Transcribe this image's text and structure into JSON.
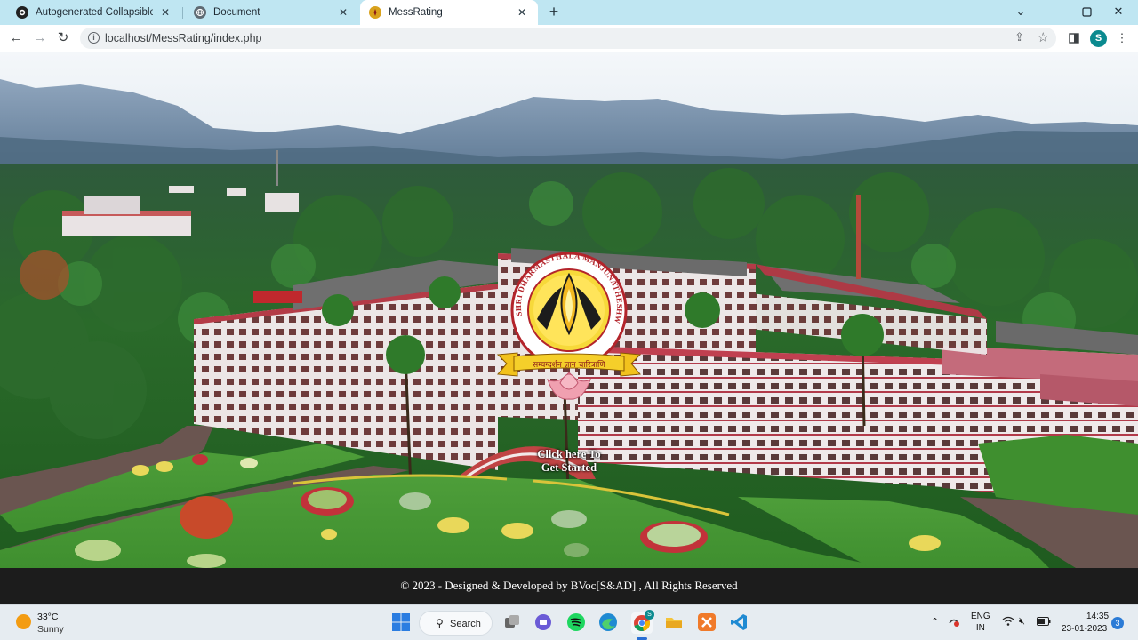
{
  "browser": {
    "tabs": [
      {
        "title": "Autogenerated Collapsible Direc",
        "icon": "github-icon"
      },
      {
        "title": "Document",
        "icon": "globe-icon"
      },
      {
        "title": "MessRating",
        "icon": "college-logo-icon"
      }
    ],
    "url": "localhost/MessRating/index.php",
    "profile_initial": "S"
  },
  "page": {
    "cta_line1": "Click here To",
    "cta_line2": "Get Started",
    "footer_text": "© 2023 - Designed & Developed by BVoc[S&AD] , All Rights Reserved",
    "logo_banner": "सम्यग्दर्शन ज्ञान चारित्राणि",
    "logo_ring_text": "SHRI DHARMASTHALA MANJUNATHESHWARA COLLEGE"
  },
  "taskbar": {
    "weather_temp": "33°C",
    "weather_cond": "Sunny",
    "search_label": "Search",
    "lang_line1": "ENG",
    "lang_line2": "IN",
    "time": "14:35",
    "date": "23-01-2023",
    "notification_count": "3",
    "chrome_badge": "S"
  },
  "colors": {
    "tab_strip": "#bfe6f2",
    "footer_bg": "#1c1c1c",
    "taskbar_bg": "#e6ecf1"
  }
}
